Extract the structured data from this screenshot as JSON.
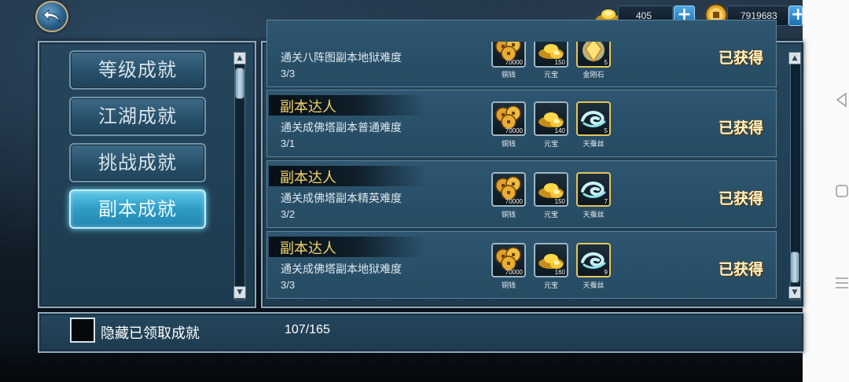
{
  "topbar": {
    "ingot_value": "405",
    "coin_value": "7919683"
  },
  "categories": [
    {
      "label": "等级成就",
      "active": false
    },
    {
      "label": "江湖成就",
      "active": false
    },
    {
      "label": "挑战成就",
      "active": false
    },
    {
      "label": "副本成就",
      "active": true
    }
  ],
  "achievements": [
    {
      "title": "",
      "desc": "通关八阵图副本地狱难度",
      "progress": "3/3",
      "status": "已获得",
      "rewards": [
        {
          "icon": "copper-coins-icon",
          "qty": "70000",
          "name": "铜钱"
        },
        {
          "icon": "gold-ingot-icon",
          "qty": "150",
          "name": "元宝"
        },
        {
          "icon": "diamond-stone-icon",
          "qty": "5",
          "name": "金刚石"
        }
      ]
    },
    {
      "title": "副本达人",
      "desc": "通关成佛塔副本普通难度",
      "progress": "3/1",
      "status": "已获得",
      "rewards": [
        {
          "icon": "copper-coins-icon",
          "qty": "70000",
          "name": "铜钱"
        },
        {
          "icon": "gold-ingot-icon",
          "qty": "140",
          "name": "元宝"
        },
        {
          "icon": "silk-icon",
          "qty": "5",
          "name": "天蚕丝"
        }
      ]
    },
    {
      "title": "副本达人",
      "desc": "通关成佛塔副本精英难度",
      "progress": "3/2",
      "status": "已获得",
      "rewards": [
        {
          "icon": "copper-coins-icon",
          "qty": "70000",
          "name": "铜钱"
        },
        {
          "icon": "gold-ingot-icon",
          "qty": "150",
          "name": "元宝"
        },
        {
          "icon": "silk-icon",
          "qty": "7",
          "name": "天蚕丝"
        }
      ]
    },
    {
      "title": "副本达人",
      "desc": "通关成佛塔副本地狱难度",
      "progress": "3/3",
      "status": "已获得",
      "rewards": [
        {
          "icon": "copper-coins-icon",
          "qty": "70000",
          "name": "铜钱"
        },
        {
          "icon": "gold-ingot-icon",
          "qty": "160",
          "name": "元宝"
        },
        {
          "icon": "silk-icon",
          "qty": "9",
          "name": "天蚕丝"
        }
      ]
    }
  ],
  "bottom": {
    "hide_label": "隐藏已领取成就",
    "total_progress": "107/165"
  },
  "colors": {
    "title_gold": "#f5d56a",
    "active_tab": "#2f9cc6",
    "panel": "#25465c"
  }
}
